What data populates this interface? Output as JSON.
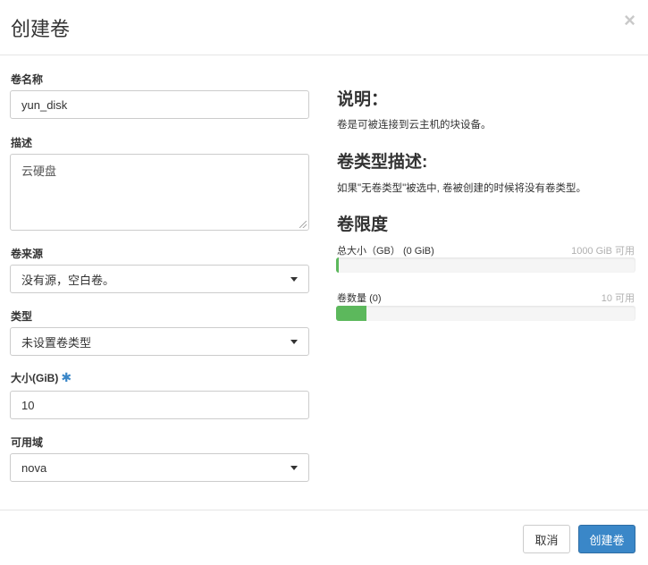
{
  "modal": {
    "title": "创建卷",
    "close_icon": "×"
  },
  "form": {
    "name": {
      "label": "卷名称",
      "value": "yun_disk"
    },
    "description": {
      "label": "描述",
      "value": "云硬盘"
    },
    "source": {
      "label": "卷来源",
      "selected": "没有源，空白卷。"
    },
    "type": {
      "label": "类型",
      "selected": "未设置卷类型"
    },
    "size": {
      "label": "大小(GiB)",
      "required_mark": "✱",
      "value": "10"
    },
    "zone": {
      "label": "可用域",
      "selected": "nova"
    }
  },
  "info": {
    "description_heading": "说明：",
    "description_text": "卷是可被连接到云主机的块设备。",
    "type_heading": "卷类型描述:",
    "type_text": "如果\"无卷类型\"被选中, 卷被创建的时候将没有卷类型。",
    "limits_heading": "卷限度"
  },
  "quota": {
    "total_size": {
      "label": "总大小（GB）",
      "used": "(0 GiB)",
      "available": "1000 GiB 可用",
      "fill_fraction": 0.01
    },
    "volume_count": {
      "label": "卷数量",
      "used": "(0)",
      "available": "10 可用",
      "fill_fraction": 0.1
    }
  },
  "footer": {
    "cancel_label": "取消",
    "submit_label": "创建卷"
  },
  "colors": {
    "primary": "#3a87c8",
    "progress": "#5cb85c"
  }
}
